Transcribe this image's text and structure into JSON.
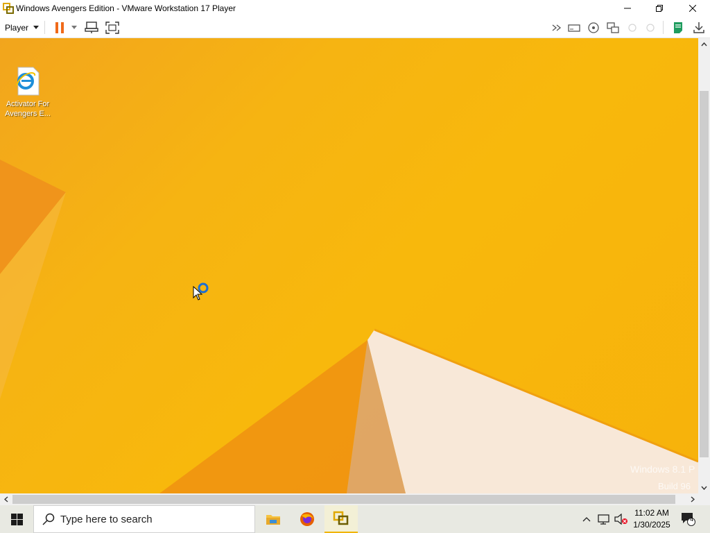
{
  "window": {
    "title": "Windows Avengers Edition - VMware Workstation 17 Player",
    "controls": [
      "minimize",
      "maximize",
      "close"
    ]
  },
  "toolbar": {
    "player_label": "Player",
    "left_icons": [
      "pause-icon",
      "dropdown-caret-icon",
      "send-ctrl-alt-del-icon",
      "fullscreen-icon"
    ],
    "right_icons": [
      "more-chevrons-icon",
      "removable-device-icon",
      "cd-dvd-icon",
      "network-icon",
      "usb-icon",
      "sound-icon",
      "notes-icon",
      "download-icon"
    ]
  },
  "desktop": {
    "icons": [
      {
        "label_line1": "Activator For",
        "label_line2": "Avengers E...",
        "icon": "internet-explorer-icon"
      }
    ],
    "watermark_line1": "Windows 8.1 P",
    "watermark_line2": "Build 96"
  },
  "taskbar": {
    "search_placeholder": "Type here to search",
    "apps": [
      "file-explorer-icon",
      "firefox-icon",
      "vmware-icon"
    ],
    "tray": {
      "time": "11:02 AM",
      "date": "1/30/2025",
      "notification_count": "4"
    }
  },
  "colors": {
    "wallpaper": "#f6b412",
    "accent": "#f0b400"
  }
}
